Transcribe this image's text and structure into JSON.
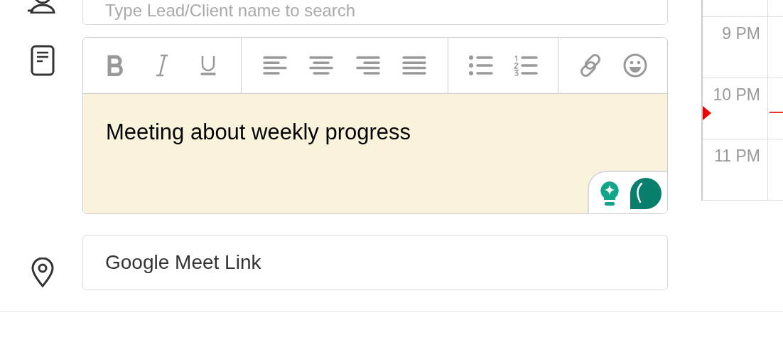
{
  "contact_search": {
    "placeholder": "Type Lead/Client name to search"
  },
  "notes": {
    "toolbar": [
      [
        {
          "kind": "bold"
        },
        {
          "kind": "italic"
        },
        {
          "kind": "underline"
        }
      ],
      [
        {
          "kind": "align-left"
        },
        {
          "kind": "align-center"
        },
        {
          "kind": "align-right"
        },
        {
          "kind": "justify"
        }
      ],
      [
        {
          "kind": "bullet-list"
        },
        {
          "kind": "numbered-list"
        }
      ],
      [
        {
          "kind": "link"
        },
        {
          "kind": "emoji"
        }
      ]
    ],
    "value": "Meeting about weekly progress"
  },
  "location": {
    "value": "Google Meet Link"
  },
  "calendar": {
    "hours": [
      "9 PM",
      "10 PM",
      "11 PM"
    ]
  }
}
